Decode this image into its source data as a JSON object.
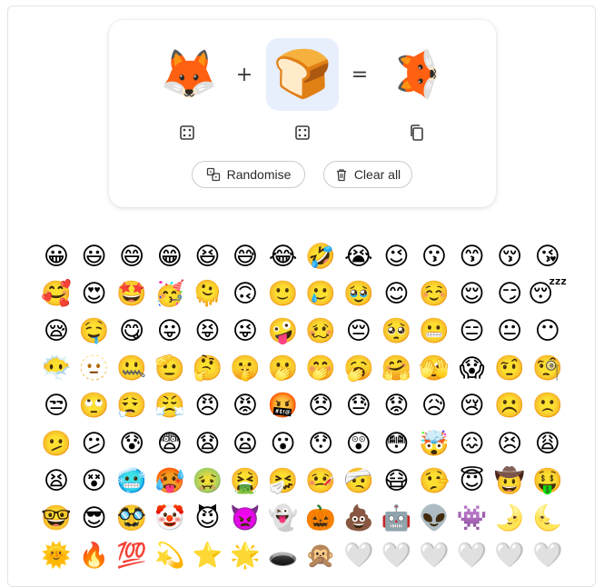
{
  "mixer": {
    "left_emoji": "🦊",
    "right_emoji": "🍞",
    "result_emoji": "🦊",
    "plus": "+",
    "equals": "="
  },
  "buttons": {
    "randomise": "Randomise",
    "clear_all": "Clear all"
  },
  "emoji_rows": [
    [
      "😀",
      "😃",
      "😄",
      "😁",
      "😆",
      "😅",
      "😂",
      "🤣",
      "😭",
      "😉",
      "😗",
      "😙",
      "😚",
      "😘"
    ],
    [
      "🥰",
      "😍",
      "🤩",
      "🥳",
      "🫠",
      "🙃",
      "🙂",
      "🥲",
      "🥹",
      "😊",
      "☺️",
      "😌",
      "😏",
      "😴"
    ],
    [
      "😪",
      "🤤",
      "😋",
      "😛",
      "😝",
      "😜",
      "🤪",
      "🥴",
      "😔",
      "🥺",
      "😬",
      "😑",
      "😐",
      "😶"
    ],
    [
      "😶‍🌫️",
      "🫥",
      "🤐",
      "🫡",
      "🤔",
      "🤫",
      "🫢",
      "🤭",
      "🥱",
      "🤗",
      "🫣",
      "😱",
      "🤨",
      "🧐"
    ],
    [
      "😒",
      "🙄",
      "😮‍💨",
      "😤",
      "😠",
      "😡",
      "🤬",
      "😞",
      "😓",
      "😟",
      "😥",
      "😢",
      "☹️",
      "🙁"
    ],
    [
      "🫤",
      "😕",
      "😰",
      "😨",
      "😧",
      "😦",
      "😮",
      "😯",
      "😲",
      "😳",
      "🤯",
      "😖",
      "😣",
      "😩"
    ],
    [
      "😫",
      "😵",
      "🥶",
      "🥵",
      "🤢",
      "🤮",
      "🤧",
      "🤒",
      "🤕",
      "😷",
      "🤥",
      "😇",
      "🤠",
      "🤑"
    ],
    [
      "🤓",
      "😎",
      "🥸",
      "🤡",
      "😈",
      "👿",
      "👻",
      "🎃",
      "💩",
      "🤖",
      "👽",
      "👾",
      "🌛",
      "🌜"
    ],
    [
      "🌞",
      "🔥",
      "💯",
      "💫",
      "⭐",
      "🌟",
      "🕳️",
      "🙊",
      "🤍",
      "🤍",
      "🤍",
      "🤍",
      "🤍",
      "🤍"
    ]
  ]
}
